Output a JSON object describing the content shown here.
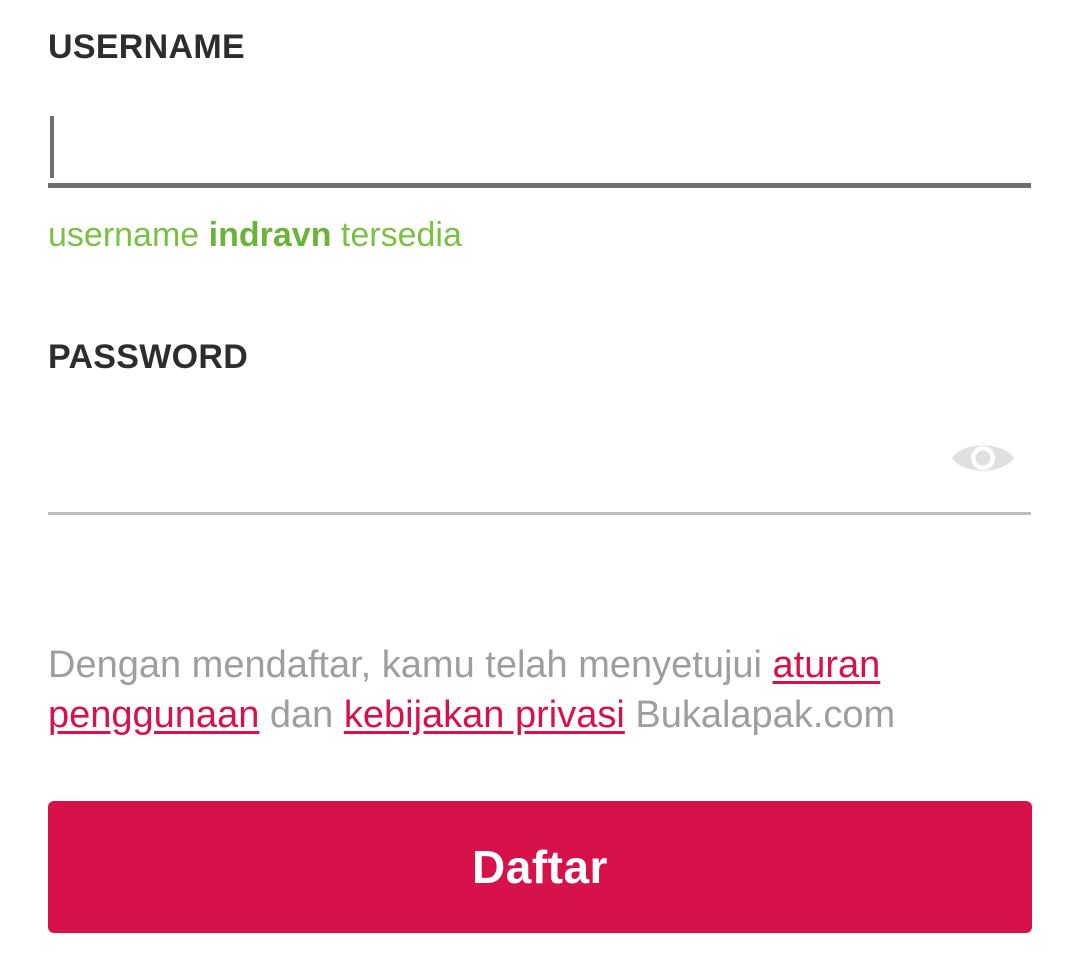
{
  "username": {
    "label": "USERNAME",
    "value": "",
    "availability": {
      "prefix": "username",
      "name": "indravn",
      "suffix": "tersedia",
      "color": "#7ac143"
    }
  },
  "password": {
    "label": "PASSWORD",
    "value": "",
    "toggle_icon": "eye-icon"
  },
  "terms": {
    "text_before": "Dengan mendaftar, kamu telah menyetujui",
    "link_terms": "aturan penggunaan",
    "text_middle": "dan",
    "link_privacy": "kebijakan privasi",
    "text_after": "Bukalapak.com",
    "link_color": "#d71149"
  },
  "submit": {
    "label": "Daftar",
    "color": "#d71149"
  }
}
